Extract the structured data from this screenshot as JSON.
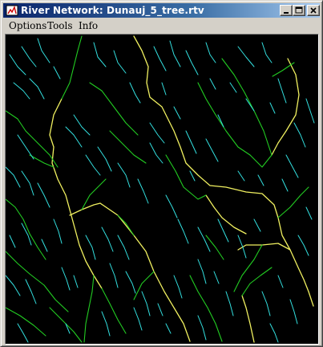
{
  "window": {
    "title": "River Network:  Dunauj_5_tree.rtv"
  },
  "titlebar_buttons": {
    "minimize": "minimize-icon",
    "maximize": "maximize-icon",
    "close": "close-icon"
  },
  "menu": {
    "items": [
      {
        "label": "Options"
      },
      {
        "label": "Tools"
      },
      {
        "label": "Info"
      }
    ]
  },
  "map": {
    "background": "#000000",
    "stream_colors": {
      "first_order": "#33e0e0",
      "second_order": "#22cc22",
      "third_order": "#99e633",
      "main_stem": "#f0f060"
    }
  }
}
